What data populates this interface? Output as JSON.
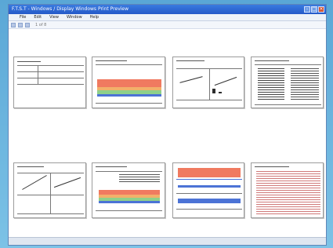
{
  "window": {
    "title": "F.T.S.T - Windows / Display Windows Print Preview",
    "controls": {
      "minimize": "-",
      "maximize": "□",
      "close": "×"
    }
  },
  "menu": {
    "items": [
      "File",
      "Edit",
      "View",
      "Window",
      "Help"
    ]
  },
  "toolbar": {
    "items": [
      "print-icon",
      "zoom-icon",
      "page-icon"
    ],
    "page_label": "1 of 8"
  },
  "preview": {
    "page_count": 8,
    "colors": {
      "red": "#f07a60",
      "orange": "#f2b06a",
      "green": "#8fd08a",
      "blue": "#4c73d6"
    }
  }
}
